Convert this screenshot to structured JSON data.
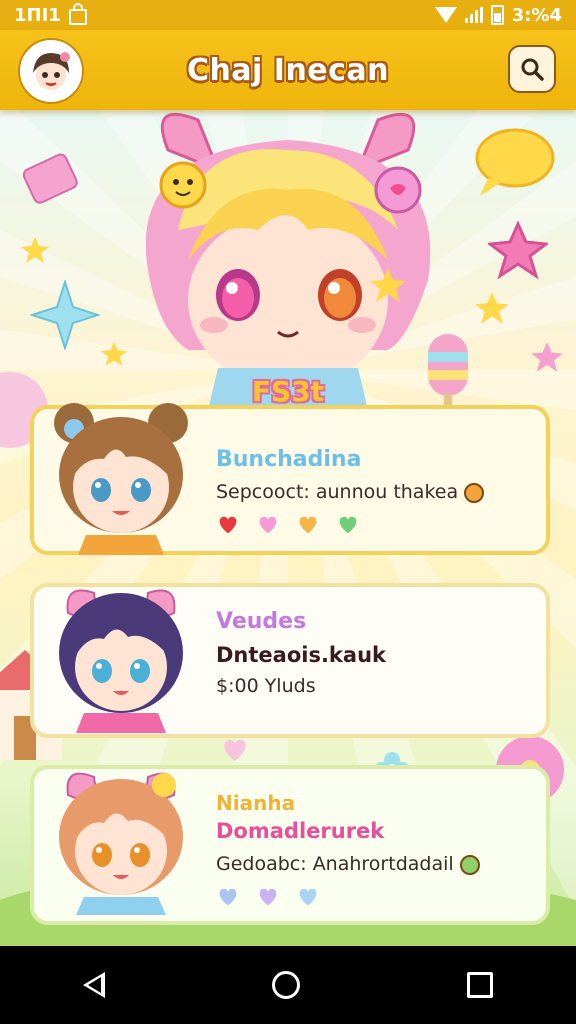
{
  "status_bar": {
    "time": "1ΠΙ1",
    "battery_text": "3:%4"
  },
  "header": {
    "title": "Chaj Inecan"
  },
  "hero": {
    "badge": "FS3t"
  },
  "cards": [
    {
      "name": "Bunchadina",
      "name_color": "#6cc0e8",
      "line1": "Sepcooct: aunnou thakea",
      "hearts": [
        "#e83a3a",
        "#f49ad6",
        "#f3b545",
        "#6ed07a"
      ]
    },
    {
      "name": "Veudes",
      "name_color": "#c27ae0",
      "line1": "Dnteaois.kauk",
      "line2": "$:00 Yluds"
    },
    {
      "name": "Nianha",
      "name_color": "#f0b23a",
      "line1": "Domadlerurek",
      "line1_color": "#e94e9a",
      "line2": "Gedoabc: Anahrortdadail",
      "hearts": [
        "#a9c4ef",
        "#c9b4f0",
        "#a9d3f3"
      ]
    }
  ],
  "colors": {
    "header": "#f2bb14",
    "status_bar": "#e7b010",
    "nav_bar": "#000000"
  },
  "icons": {
    "search": "search-icon",
    "back": "back-icon",
    "home": "home-icon",
    "recent": "recent-apps-icon"
  }
}
